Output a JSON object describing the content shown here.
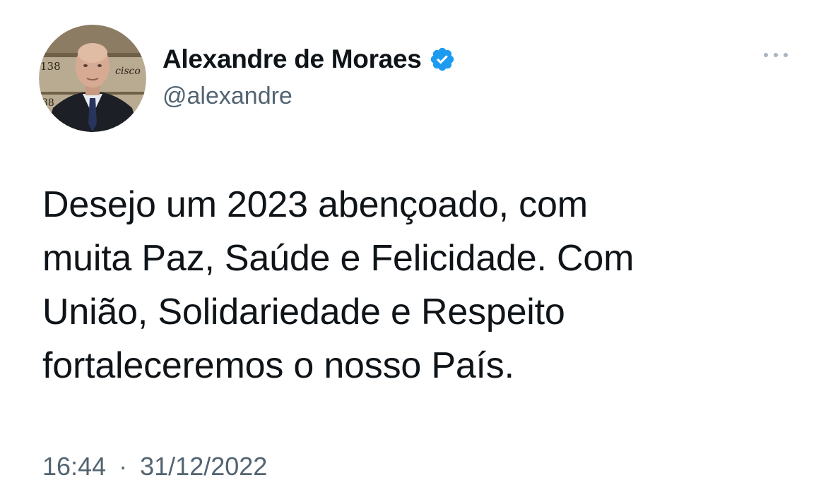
{
  "tweet": {
    "author": {
      "display_name": "Alexandre de Moraes",
      "handle": "@alexandre",
      "verified": true,
      "avatar_icon": "profile-photo",
      "avatar_background_text": [
        "138",
        "cisco",
        "38"
      ]
    },
    "more_icon": "more-horizontal-icon",
    "text_lines": [
      "Desejo um 2023 abençoado, com",
      "muita Paz, Saúde e Felicidade. Com",
      "União, Solidariedade e Respeito",
      "fortaleceremos o nosso País."
    ],
    "time": "16:44",
    "separator": "·",
    "date": "31/12/2022"
  },
  "colors": {
    "text_primary": "#0f1419",
    "text_secondary": "#536471",
    "verified_blue": "#1d9bf0",
    "background": "#ffffff"
  }
}
